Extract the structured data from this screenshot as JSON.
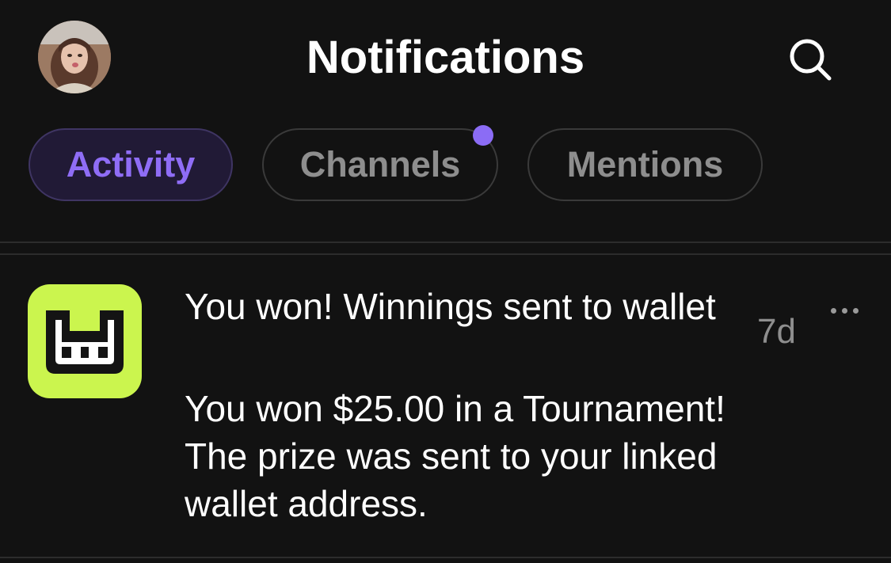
{
  "header": {
    "title": "Notifications",
    "avatar_icon": "user-avatar",
    "search_icon": "search-icon"
  },
  "tabs": [
    {
      "label": "Activity",
      "active": true
    },
    {
      "label": "Channels",
      "active": false,
      "unread_dot": true
    },
    {
      "label": "Mentions",
      "active": false
    }
  ],
  "notification": {
    "app_icon": "app-logo-icon",
    "title": "You won! Winnings sent to wallet",
    "body": "You won $25.00 in a Tournament! The prize was sent to your linked wallet address.",
    "time": "7d",
    "more_icon": "more-horizontal-icon"
  },
  "colors": {
    "background": "#121212",
    "accent": "#8b6cf5",
    "active_tab_bg": "#211a36",
    "app_icon_bg": "#cbf54e",
    "muted_text": "#8e8e8e"
  }
}
